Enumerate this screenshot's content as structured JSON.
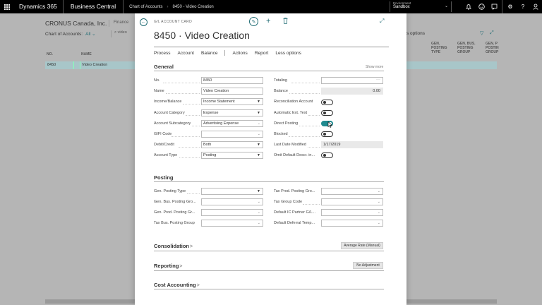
{
  "topbar": {
    "brand": "Dynamics 365",
    "app": "Business Central",
    "breadcrumb": [
      "Chart of Accounts",
      "8450 - Video Creation"
    ],
    "environment_label": "Environment",
    "environment_value": "Sandbox"
  },
  "background": {
    "company": "CRONUS Canada, Inc.",
    "nav_item": "Finance",
    "list_title": "Chart of Accounts:",
    "filter": "All",
    "search_text": "video",
    "options_text": "s options",
    "columns": {
      "no": "NO.",
      "name": "NAME",
      "gen_posting_type": "GEN. POSTING TYPE",
      "gen_bus_posting_group": "GEN. BUS. POSTING GROUP",
      "gen_prod_posting_group": "GEN. P POSTIN GROUP"
    },
    "selected_row": {
      "no": "8450",
      "name": "Video Creation"
    }
  },
  "card": {
    "type_label": "G/L ACCOUNT CARD",
    "title": "8450 · Video Creation",
    "menu": [
      "Process",
      "Account",
      "Balance",
      "Actions",
      "Report",
      "Less options"
    ],
    "general": {
      "heading": "General",
      "show_more": "Show more",
      "left_fields": [
        {
          "label": "No.",
          "value": "8450",
          "kind": "text"
        },
        {
          "label": "Name",
          "value": "Video Creation",
          "kind": "text"
        },
        {
          "label": "Income/Balance",
          "value": "Income Statement",
          "kind": "select"
        },
        {
          "label": "Account Category",
          "value": "Expense",
          "kind": "select"
        },
        {
          "label": "Account Subcategory",
          "value": "Advertising Expense",
          "kind": "lookup"
        },
        {
          "label": "GIFI Code",
          "value": "",
          "kind": "lookup"
        },
        {
          "label": "Debit/Credit",
          "value": "Both",
          "kind": "select"
        },
        {
          "label": "Account Type",
          "value": "Posting",
          "kind": "select"
        }
      ],
      "right_fields": {
        "totaling_label": "Totaling",
        "totaling_value": "",
        "balance_label": "Balance",
        "balance_value": "0.00",
        "reconciliation_label": "Reconciliation Account",
        "reconciliation_on": false,
        "auto_ext_text_label": "Automatic Ext. Text",
        "auto_ext_text_on": false,
        "direct_posting_label": "Direct Posting",
        "direct_posting_on": true,
        "blocked_label": "Blocked",
        "blocked_on": false,
        "last_modified_label": "Last Date Modified",
        "last_modified_value": "1/17/2019",
        "omit_descr_label": "Omit Default Descr. in...",
        "omit_descr_on": false
      }
    },
    "posting": {
      "heading": "Posting",
      "left_labels": [
        "Gen. Posting Type",
        "Gen. Bus. Posting Gro...",
        "Gen. Prod. Posting Gr...",
        "Tax Bus. Posting Group"
      ],
      "right_labels": [
        "Tax Prod. Posting Gro...",
        "Tax Group Code",
        "Default IC Partner G/L...",
        "Default Deferral Temp..."
      ]
    },
    "consolidation": {
      "heading": "Consolidation",
      "chevron": ">",
      "button": "Average Rate (Manual)"
    },
    "reporting": {
      "heading": "Reporting",
      "chevron": ">",
      "button": "No Adjustment"
    },
    "cost_accounting": {
      "heading": "Cost Accounting",
      "chevron": ">"
    }
  },
  "icons": {
    "waffle": "app-launcher-icon",
    "back": "back-arrow-icon",
    "edit": "pencil-icon",
    "new": "plus-icon",
    "delete": "trash-icon",
    "expand": "expand-icon"
  }
}
